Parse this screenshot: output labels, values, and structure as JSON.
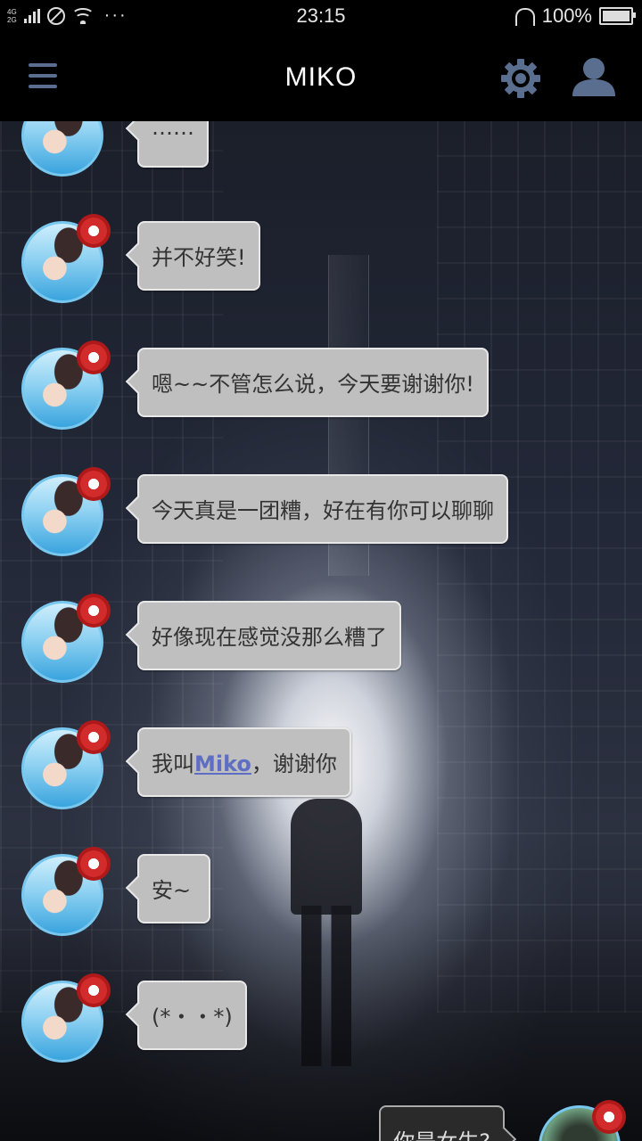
{
  "status_bar": {
    "network_label": "4G¹\n2G",
    "time": "23:15",
    "battery": "100%",
    "more_dots": "···"
  },
  "app_bar": {
    "title": "MIKO",
    "menu_icon": "hamburger-menu-icon",
    "settings_icon": "gear-icon",
    "profile_icon": "user-icon"
  },
  "colors": {
    "accent_icon": "#5a6f8f",
    "bubble_in": "#bfbfbf",
    "name_link": "#5d6ec4"
  },
  "messages": [
    {
      "sender": "miko",
      "text": "……"
    },
    {
      "sender": "miko",
      "text": "并不好笑!"
    },
    {
      "sender": "miko",
      "text": "嗯~~不管怎么说，今天要谢谢你!"
    },
    {
      "sender": "miko",
      "text": "今天真是一团糟，好在有你可以聊聊"
    },
    {
      "sender": "miko",
      "text": "好像现在感觉没那么糟了"
    },
    {
      "sender": "miko",
      "text_before": "我叫",
      "name": "Miko",
      "text_after": "，谢谢你"
    },
    {
      "sender": "miko",
      "text": "安~"
    },
    {
      "sender": "miko",
      "text": "(*・・*)"
    },
    {
      "sender": "user",
      "text": "你是女生?"
    }
  ]
}
